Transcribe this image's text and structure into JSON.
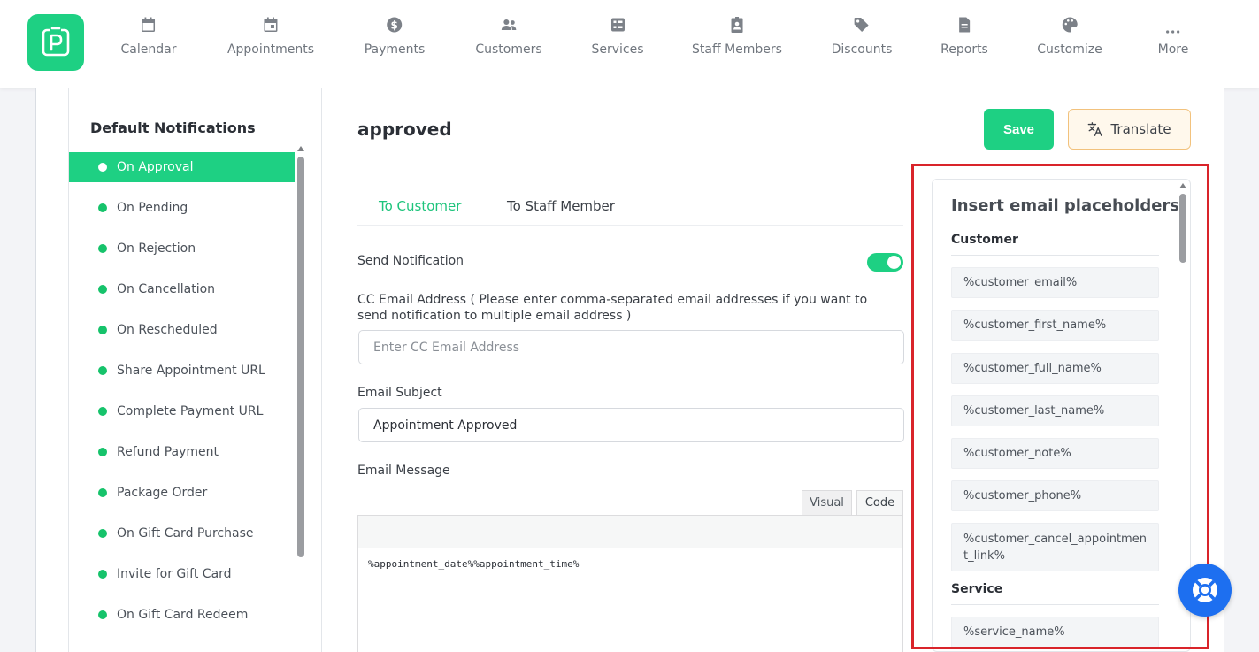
{
  "nav": {
    "items": [
      {
        "label": "Calendar",
        "icon": "calendar-icon"
      },
      {
        "label": "Appointments",
        "icon": "calendar-check-icon"
      },
      {
        "label": "Payments",
        "icon": "dollar-icon"
      },
      {
        "label": "Customers",
        "icon": "users-icon"
      },
      {
        "label": "Services",
        "icon": "list-icon"
      },
      {
        "label": "Staff Members",
        "icon": "id-badge-icon"
      },
      {
        "label": "Discounts",
        "icon": "tag-icon"
      },
      {
        "label": "Reports",
        "icon": "file-icon"
      },
      {
        "label": "Customize",
        "icon": "palette-icon"
      },
      {
        "label": "More",
        "icon": "more-dots-icon"
      }
    ]
  },
  "sidebar": {
    "title": "Default Notifications",
    "items": [
      {
        "label": "On Approval",
        "active": true
      },
      {
        "label": "On Pending"
      },
      {
        "label": "On Rejection"
      },
      {
        "label": "On Cancellation"
      },
      {
        "label": "On Rescheduled"
      },
      {
        "label": "Share Appointment URL"
      },
      {
        "label": "Complete Payment URL"
      },
      {
        "label": "Refund Payment"
      },
      {
        "label": "Package Order"
      },
      {
        "label": "On Gift Card Purchase"
      },
      {
        "label": "Invite for Gift Card"
      },
      {
        "label": "On Gift Card Redeem"
      }
    ]
  },
  "main": {
    "title": "approved",
    "save_label": "Save",
    "translate_label": "Translate",
    "tabs": [
      {
        "label": "To Customer",
        "active": true
      },
      {
        "label": "To Staff Member"
      }
    ],
    "send_notification_label": "Send Notification",
    "send_notification_on": true,
    "cc_label": "CC Email Address ( Please enter comma-separated email addresses if you want to send notification to multiple email address )",
    "cc_placeholder": "Enter CC Email Address",
    "cc_value": "",
    "subject_label": "Email Subject",
    "subject_value": "Appointment Approved",
    "message_label": "Email Message",
    "editor_tab_visual": "Visual",
    "editor_tab_code": "Code",
    "message_value": "%appointment_date%%appointment_time%"
  },
  "placeholders": {
    "title": "Insert email placeholders",
    "sections": [
      {
        "heading": "Customer",
        "items": [
          "%customer_email%",
          "%customer_first_name%",
          "%customer_full_name%",
          "%customer_last_name%",
          "%customer_note%",
          "%customer_phone%",
          "%customer_cancel_appointment_link%"
        ]
      },
      {
        "heading": "Service",
        "items": [
          "%service_name%"
        ]
      }
    ]
  },
  "colors": {
    "accent": "#1ed083",
    "highlight": "#d9242a",
    "help": "#1d6ff0"
  }
}
